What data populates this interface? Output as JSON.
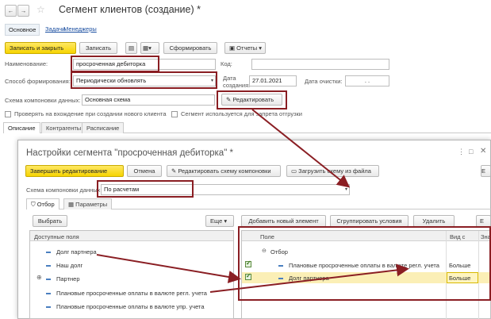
{
  "window": {
    "title": "Сегмент клиентов (создание) *",
    "nav_back": "←",
    "nav_forward": "→",
    "tabs": [
      "Основное",
      "Задачи",
      "Менеджеры"
    ]
  },
  "toolbar": {
    "save_close": "Записать и закрыть",
    "save": "Записать",
    "form": "Сформировать",
    "reports": "Отчеты"
  },
  "form": {
    "name_label": "Наименование:",
    "name_value": "просроченная дебиторка",
    "code_label": "Код:",
    "code_value": "",
    "method_label": "Способ формирования:",
    "method_value": "Периодически обновлять",
    "created_label_1": "Дата",
    "created_label_2": "создания:",
    "created_value": "27.01.2021",
    "clear_label": "Дата очистки:",
    "clear_value": ". .",
    "scheme_label": "Схема компоновки данных:",
    "scheme_value": "Основная схема",
    "edit_button": "Редактировать",
    "check_new_client": "Проверять на вхождение при создании нового клиента",
    "check_block": "Сегмент используется для запрета отгрузки"
  },
  "subtabs": [
    "Описание",
    "Контрагенты",
    "Расписание"
  ],
  "dialog": {
    "title": "Настройки сегмента \"просроченная дебиторка\" *",
    "finish_edit": "Завершить редактирование",
    "cancel": "Отмена",
    "edit_scheme": "Редактировать схему компоновки",
    "load_scheme": "Загрузить схему из файла",
    "scheme_label": "Схема компоновки данных:",
    "scheme_value": "По расчетам",
    "tabs": [
      "Отбор",
      "Параметры"
    ],
    "select_btn": "Выбрать",
    "more_btn": "Еще",
    "add_btn": "Добавить новый элемент",
    "group_btn": "Сгруппировать условия",
    "delete_btn": "Удалить",
    "more_right": "Е",
    "available_header": "Доступные поля",
    "available_fields": [
      "Долг партнера",
      "Наш долг",
      "Партнер",
      "Плановые просроченные оплаты в валюте регл. учета",
      "Плановые просроченные оплаты в валюте упр. учета"
    ],
    "grid_headers": [
      "Поле",
      "Вид с",
      "Знач"
    ],
    "grid_root": "Отбор",
    "grid_rows": [
      {
        "field": "Плановые просроченные оплаты в валюте регл. учета",
        "kind": "Больше",
        "value": ""
      },
      {
        "field": "Долг партнера",
        "kind": "Больше",
        "value": ""
      }
    ]
  }
}
